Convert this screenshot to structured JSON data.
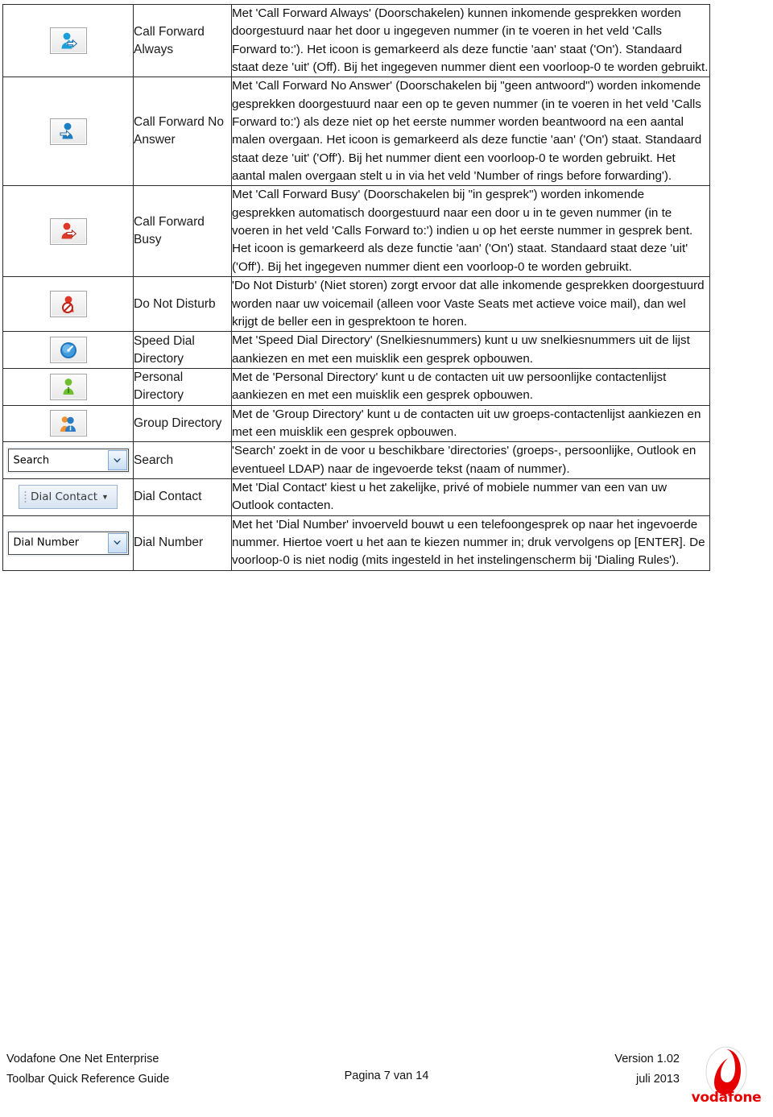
{
  "document": {
    "table": {
      "rows": [
        {
          "icon": "call-forward-always-icon",
          "icon_type": "button",
          "label": "Call Forward Always",
          "description": "Met 'Call Forward Always' (Doorschakelen) kunnen inkomende gesprekken worden doorgestuurd naar het door u ingegeven nummer (in te voeren in het veld 'Calls Forward to:'). Het icoon is gemarkeerd als deze functie 'aan' staat ('On'). Standaard staat deze 'uit' (Off). Bij het ingegeven nummer dient een voorloop-0 te worden gebruikt."
        },
        {
          "icon": "call-forward-no-answer-icon",
          "icon_type": "button",
          "label": "Call Forward No Answer",
          "description": "Met 'Call Forward No Answer' (Doorschakelen bij \"geen antwoord\") worden inkomende gesprekken doorgestuurd naar een op te geven nummer (in te voeren in het veld 'Calls Forward to:') als deze niet op het eerste nummer worden beantwoord na een aantal malen overgaan. Het icoon is gemarkeerd als deze functie 'aan' ('On') staat. Standaard staat deze 'uit' ('Off'). Bij het nummer dient een voorloop-0 te worden gebruikt. Het aantal malen overgaan stelt u in via het veld 'Number of rings before forwarding')."
        },
        {
          "icon": "call-forward-busy-icon",
          "icon_type": "button",
          "label": "Call Forward Busy",
          "description": "Met 'Call Forward Busy' (Doorschakelen bij \"in gesprek\") worden inkomende gesprekken automatisch doorgestuurd naar een door u in te geven nummer  (in te voeren in het veld 'Calls Forward to:') indien u op het eerste nummer in gesprek bent. Het icoon is gemarkeerd als deze functie 'aan' ('On') staat. Standaard staat deze 'uit' ('Off'). Bij het ingegeven nummer dient een voorloop-0 te worden gebruikt."
        },
        {
          "icon": "do-not-disturb-icon",
          "icon_type": "button",
          "label": "Do Not Disturb",
          "description": "'Do Not Disturb' (Niet storen) zorgt ervoor dat alle inkomende gesprekken doorgestuurd worden naar uw voicemail (alleen voor Vaste Seats met actieve voice mail), dan wel krijgt de beller een in gesprektoon te horen."
        },
        {
          "icon": "speed-dial-directory-icon",
          "icon_type": "button",
          "label": "Speed Dial Directory",
          "description": "Met 'Speed Dial Directory' (Snelkiesnummers) kunt u uw snelkiesnummers uit de lijst aankiezen en met een muisklik een gesprek opbouwen."
        },
        {
          "icon": "personal-directory-icon",
          "icon_type": "button",
          "label": "Personal Directory",
          "description": "Met de 'Personal Directory' kunt u de contacten uit uw persoonlijke contactenlijst aankiezen en met een muisklik een gesprek opbouwen."
        },
        {
          "icon": "group-directory-icon",
          "icon_type": "button",
          "label": "Group Directory",
          "description": "Met de 'Group Directory' kunt u de contacten uit uw groeps-contactenlijst aankiezen en met een muisklik een gesprek opbouwen."
        },
        {
          "icon": "search-combobox",
          "icon_type": "combobox",
          "widget_text": "Search",
          "label": "Search",
          "description": "'Search' zoekt in de voor u beschikbare 'directories' (groeps-, persoonlijke, Outlook en eventueel LDAP) naar de ingevoerde tekst (naam of nummer)."
        },
        {
          "icon": "dial-contact-button",
          "icon_type": "splitbutton",
          "widget_text": "Dial Contact",
          "label": "Dial Contact",
          "description": "Met 'Dial Contact' kiest u het zakelijke, privé of mobiele nummer van een van uw Outlook contacten."
        },
        {
          "icon": "dial-number-combobox",
          "icon_type": "combobox",
          "widget_text": "Dial Number",
          "label": "Dial Number",
          "description": "Met het 'Dial Number' invoerveld bouwt u een telefoongesprek op naar het ingevoerde nummer. Hiertoe voert u het aan te kiezen nummer in; druk vervolgens op [ENTER]. De voorloop-0 is niet nodig (mits ingesteld in het instelingenscherm bij 'Dialing Rules')."
        }
      ]
    },
    "footer": {
      "product": "Vodafone One Net Enterprise",
      "guide": "Toolbar Quick Reference Guide",
      "page": "Pagina 7 van 14",
      "version": "Version 1.02",
      "date": "juli 2013",
      "brand": "vodafone",
      "brand_color": "#e60000"
    }
  }
}
